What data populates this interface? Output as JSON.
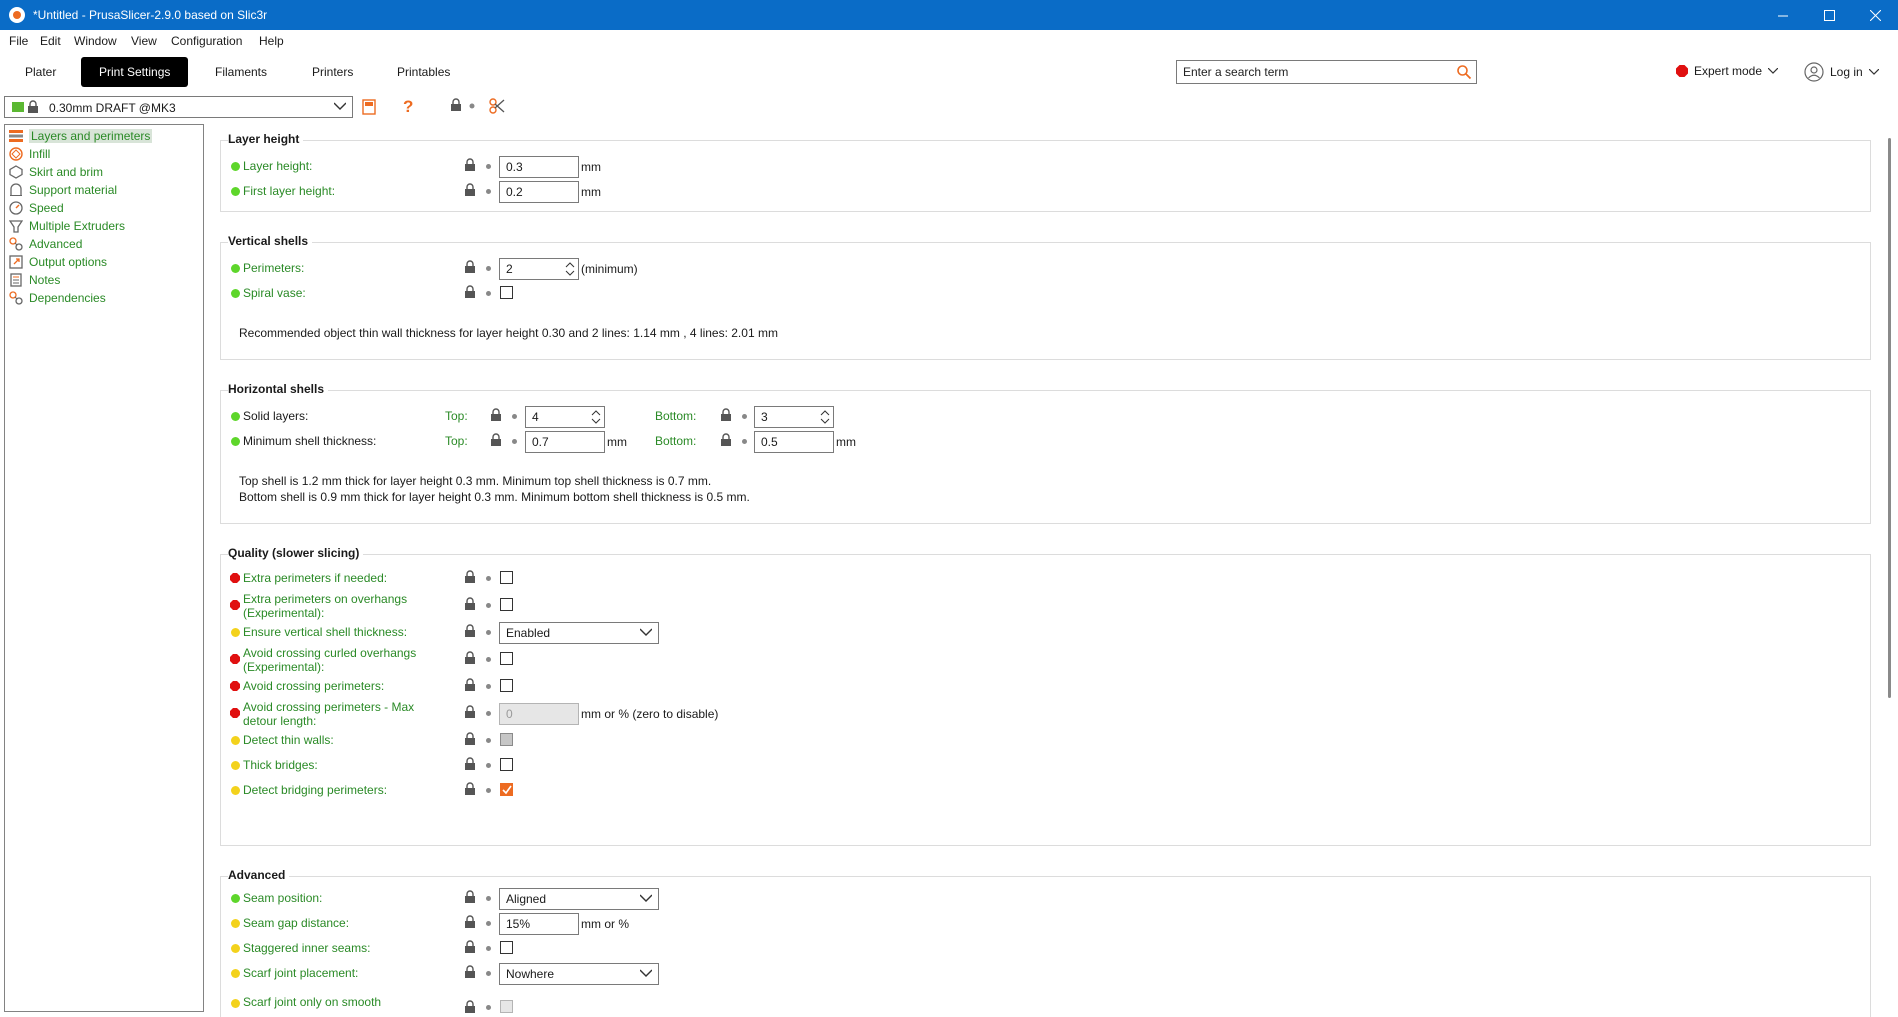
{
  "window": {
    "title": "*Untitled - PrusaSlicer-2.9.0 based on Slic3r"
  },
  "menu": [
    "File",
    "Edit",
    "Window",
    "View",
    "Configuration",
    "Help"
  ],
  "tabs": [
    "Plater",
    "Print Settings",
    "Filaments",
    "Printers",
    "Printables"
  ],
  "search": {
    "placeholder": "Enter a search term"
  },
  "mode": {
    "label": "Expert mode"
  },
  "login": {
    "label": "Log in"
  },
  "preset": {
    "name": "0.30mm DRAFT @MK3"
  },
  "sidebar": [
    "Layers and perimeters",
    "Infill",
    "Skirt and brim",
    "Support material",
    "Speed",
    "Multiple Extruders",
    "Advanced",
    "Output options",
    "Notes",
    "Dependencies"
  ],
  "groups": {
    "layer_height": {
      "title": "Layer height",
      "layer_height": {
        "label": "Layer height:",
        "value": "0.3",
        "unit": "mm"
      },
      "first_layer_height": {
        "label": "First layer height:",
        "value": "0.2",
        "unit": "mm"
      }
    },
    "vertical_shells": {
      "title": "Vertical shells",
      "perimeters": {
        "label": "Perimeters:",
        "value": "2",
        "unit": "(minimum)"
      },
      "spiral_vase": {
        "label": "Spiral vase:"
      },
      "note": "Recommended object thin wall thickness for layer height 0.30 and 2 lines: 1.14 mm , 4 lines: 2.01 mm"
    },
    "horizontal_shells": {
      "title": "Horizontal shells",
      "solid_layers": {
        "label": "Solid layers:",
        "top_label": "Top:",
        "top": "4",
        "bottom_label": "Bottom:",
        "bottom": "3"
      },
      "min_shell": {
        "label": "Minimum shell thickness:",
        "top_label": "Top:",
        "top": "0.7",
        "bottom_label": "Bottom:",
        "bottom": "0.5",
        "unit": "mm"
      },
      "note1": "Top shell is 1.2 mm thick for layer height 0.3 mm. Minimum top shell thickness is 0.7 mm.",
      "note2": "Bottom shell is 0.9 mm thick for layer height 0.3 mm. Minimum bottom shell thickness is 0.5 mm."
    },
    "quality": {
      "title": "Quality (slower slicing)",
      "extra_perimeters": "Extra perimeters if needed:",
      "extra_overhangs_1": "Extra perimeters on overhangs",
      "extra_overhangs_2": "(Experimental):",
      "ensure_vertical": "Ensure vertical shell thickness:",
      "ensure_vertical_value": "Enabled",
      "avoid_curled_1": "Avoid crossing curled overhangs",
      "avoid_curled_2": "(Experimental):",
      "avoid_crossing": "Avoid crossing perimeters:",
      "max_detour_1": "Avoid crossing perimeters - Max",
      "max_detour_2": "detour length:",
      "max_detour_value": "0",
      "max_detour_unit": "mm or % (zero to disable)",
      "thin_walls": "Detect thin walls:",
      "thick_bridges": "Thick bridges:",
      "bridging_perimeters": "Detect bridging perimeters:"
    },
    "advanced": {
      "title": "Advanced",
      "seam_position": "Seam position:",
      "seam_position_value": "Aligned",
      "seam_gap": "Seam gap distance:",
      "seam_gap_value": "15%",
      "seam_gap_unit": "mm or %",
      "staggered": "Staggered inner seams:",
      "scarf": "Scarf joint placement:",
      "scarf_value": "Nowhere",
      "scarf_smooth": "Scarf joint only on smooth"
    }
  },
  "colors": {
    "titlebar": "#0a6cc7",
    "accent": "#ed6b21",
    "label_green": "#2a8a26"
  }
}
